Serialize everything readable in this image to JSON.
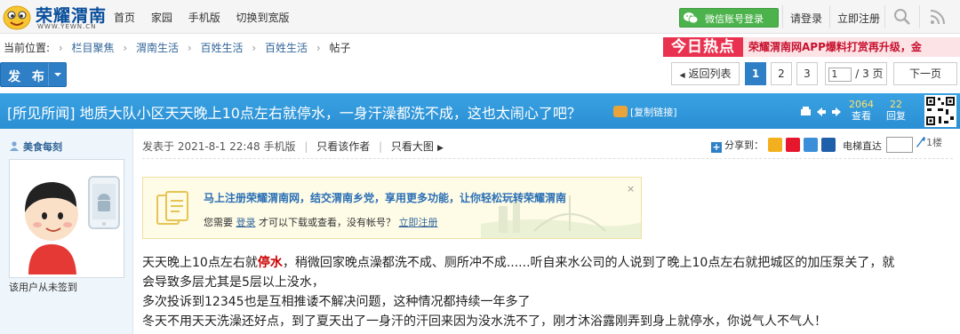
{
  "site": {
    "name": "荣耀渭南",
    "url": "WWW.YEWN.CN"
  },
  "nav": {
    "items": [
      "首页",
      "家园",
      "手机版",
      "切换到宽版"
    ]
  },
  "topbar": {
    "wechat_login": "微信账号登录",
    "login": "请登录",
    "register": "立即注册"
  },
  "breadcrumb": {
    "prefix": "当前位置:",
    "items": [
      "栏目聚焦",
      "渭南生活",
      "百姓生活",
      "百姓生活",
      "帖子"
    ]
  },
  "hot_banner": {
    "label": "今日热点",
    "text": "荣耀渭南网APP爆料打赏再升级，金"
  },
  "toolbar": {
    "post_label": "发 布"
  },
  "pagination": {
    "back": "返回列表",
    "pages": [
      "1",
      "2",
      "3"
    ],
    "current_page": "1",
    "total": "/ 3 页",
    "next": "下一页"
  },
  "thread": {
    "title": "[所见所闻] 地质大队小区天天晚上10点左右就停水，一身汗澡都洗不成，这也太闹心了吧？",
    "copy_link": "[复制链接]",
    "views": "2064",
    "views_label": "查看",
    "replies": "22",
    "replies_label": "回复"
  },
  "author": {
    "name": "美食每刻",
    "status": "该用户从未签到"
  },
  "post_meta": {
    "posted": "发表于 2021-8-1 22:48 手机版",
    "only_author": "只看该作者",
    "only_images": "只看大图",
    "share": "分享到：",
    "elevator": "电梯直达",
    "floor": "1楼"
  },
  "register_prompt": {
    "title": "马上注册荣耀渭南网，结交渭南乡党，享用更多功能，让你轻松玩转荣耀渭南",
    "sub_before": "您需要",
    "login_link": "登录",
    "sub_middle": "才可以下载或查看，没有帐号？",
    "register_link": "立即注册",
    "close": "×"
  },
  "body": {
    "line1_before": "天天晚上10点左右就",
    "line1_keyword": "停水",
    "line1_after": "，稍微回家晚点澡都洗不成、厕所冲不成......听自来水公司的人说到了晚上10点左右就把城区的加压泵关了，就",
    "line2": "会导致多层尤其是5层以上没水，",
    "line3": "多次投诉到12345也是互相推诿不解决问题，这种情况都持续一年多了",
    "line4": "冬天不用天天洗澡还好点，到了夏天出了一身汗的汗回来因为没水洗不了，刚才沐浴露刚弄到身上就停水，你说气人不气人！"
  },
  "colors": {
    "accent_blue": "#2f7fc6",
    "title_bar": "#3aa2e3",
    "wechat_green": "#4cb24c",
    "hot_red": "#e8324f",
    "keyword_red": "#cc0000"
  }
}
